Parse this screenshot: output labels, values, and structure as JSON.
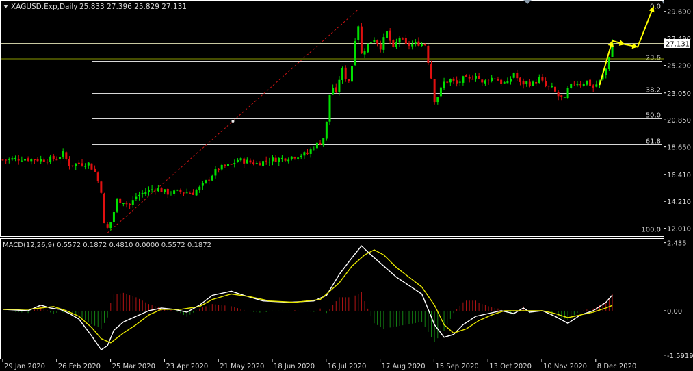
{
  "header": {
    "symbol": "XAGUSD.Exp,Daily",
    "ohlc": "25.833 27.396 25.829 27.131"
  },
  "colors": {
    "background": "#000000",
    "grid": "#ffffff",
    "bull": "#00e000",
    "bear": "#e01010",
    "fib_line": "#d8d8d8",
    "fib_diag": "#c81414",
    "price_line": "#c8c8a0",
    "arrows": "#ffff00",
    "macd_line": "#ffffff",
    "signal_line": "#e8e800",
    "hist_pos": "#b41414",
    "hist_neg": "#148214",
    "text": "#d8d8d8"
  },
  "icons": [
    "dropdown-triangle-icon",
    "scroll-marker-icon",
    "shift-marker-icon"
  ],
  "price_scale": {
    "ticks": [
      "29.690",
      "27.490",
      "25.290",
      "23.050",
      "20.850",
      "18.650",
      "16.410",
      "14.210",
      "12.010"
    ],
    "current_price": "27.131"
  },
  "fibonacci": {
    "levels": [
      {
        "label": "0.0",
        "price": 29.86
      },
      {
        "label": "23.6",
        "price": 25.65
      },
      {
        "label": "38.2",
        "price": 23.05
      },
      {
        "label": "50.0",
        "price": 20.95
      },
      {
        "label": "61.8",
        "price": 18.85
      },
      {
        "label": "100.0",
        "price": 11.64
      }
    ]
  },
  "x_axis": {
    "labels": [
      "29 Jan 2020",
      "26 Feb 2020",
      "25 Mar 2020",
      "23 Apr 2020",
      "21 May 2020",
      "18 Jun 2020",
      "16 Jul 2020",
      "17 Aug 2020",
      "15 Sep 2020",
      "13 Oct 2020",
      "10 Nov 2020",
      "8 Dec 2020"
    ]
  },
  "macd": {
    "label": "MACD(12,26,9) 0.5572 0.1872 0.4810 0.0000 0.5572 0.1872",
    "ticks": [
      "2.435",
      "0.00",
      "-1.5919"
    ]
  },
  "chart_data": {
    "type": "candlestick",
    "title": "XAGUSD.Exp,Daily",
    "ylim": [
      11.6,
      30.4
    ],
    "x_labels": [
      "29 Jan 2020",
      "26 Feb 2020",
      "25 Mar 2020",
      "23 Apr 2020",
      "21 May 2020",
      "18 Jun 2020",
      "16 Jul 2020",
      "17 Aug 2020",
      "15 Sep 2020",
      "13 Oct 2020",
      "10 Nov 2020",
      "8 Dec 2020"
    ],
    "close_path": [
      [
        0,
        17.6
      ],
      [
        6,
        17.7
      ],
      [
        12,
        17.6
      ],
      [
        17,
        17.7
      ],
      [
        19,
        18.1
      ],
      [
        21,
        17.2
      ],
      [
        24,
        17.3
      ],
      [
        27,
        17.3
      ],
      [
        29,
        16.6
      ],
      [
        31,
        15.1
      ],
      [
        32,
        12.3
      ],
      [
        33,
        12.0
      ],
      [
        34,
        12.5
      ],
      [
        36,
        14.3
      ],
      [
        38,
        14.2
      ],
      [
        40,
        13.9
      ],
      [
        42,
        14.6
      ],
      [
        45,
        15.0
      ],
      [
        48,
        15.3
      ],
      [
        52,
        14.9
      ],
      [
        56,
        15.0
      ],
      [
        60,
        14.9
      ],
      [
        62,
        15.3
      ],
      [
        64,
        15.8
      ],
      [
        66,
        16.4
      ],
      [
        68,
        16.9
      ],
      [
        72,
        17.2
      ],
      [
        74,
        17.6
      ],
      [
        76,
        17.5
      ],
      [
        80,
        17.3
      ],
      [
        84,
        17.6
      ],
      [
        88,
        17.7
      ],
      [
        92,
        17.9
      ],
      [
        96,
        18.1
      ],
      [
        98,
        18.7
      ],
      [
        100,
        19.0
      ],
      [
        101,
        19.4
      ],
      [
        102,
        20.6
      ],
      [
        103,
        22.9
      ],
      [
        104,
        23.5
      ],
      [
        105,
        22.9
      ],
      [
        106,
        24.2
      ],
      [
        107,
        24.9
      ],
      [
        108,
        24.3
      ],
      [
        109,
        24.1
      ],
      [
        110,
        25.3
      ],
      [
        111,
        27.5
      ],
      [
        112,
        28.6
      ],
      [
        113,
        26.2
      ],
      [
        115,
        27.0
      ],
      [
        117,
        27.5
      ],
      [
        119,
        26.8
      ],
      [
        121,
        28.0
      ],
      [
        123,
        26.6
      ],
      [
        125,
        27.6
      ],
      [
        127,
        26.9
      ],
      [
        129,
        27.0
      ],
      [
        131,
        27.1
      ],
      [
        133,
        27.0
      ],
      [
        135,
        24.3
      ],
      [
        136,
        22.5
      ],
      [
        137,
        22.8
      ],
      [
        139,
        23.9
      ],
      [
        141,
        24.1
      ],
      [
        143,
        23.8
      ],
      [
        145,
        24.2
      ],
      [
        147,
        24.1
      ],
      [
        149,
        24.6
      ],
      [
        151,
        23.8
      ],
      [
        153,
        24.2
      ],
      [
        155,
        24.3
      ],
      [
        157,
        23.9
      ],
      [
        159,
        23.8
      ],
      [
        161,
        24.7
      ],
      [
        163,
        23.8
      ],
      [
        165,
        23.9
      ],
      [
        167,
        23.8
      ],
      [
        169,
        24.2
      ],
      [
        171,
        23.6
      ],
      [
        173,
        23.4
      ],
      [
        175,
        22.8
      ],
      [
        177,
        22.5
      ],
      [
        178,
        23.3
      ],
      [
        180,
        23.9
      ],
      [
        182,
        23.8
      ],
      [
        184,
        24.0
      ],
      [
        186,
        23.5
      ],
      [
        188,
        24.0
      ],
      [
        190,
        25.0
      ],
      [
        192,
        27.1
      ]
    ],
    "projection_arrows": [
      [
        [
          188,
          23.7
        ],
        [
          192,
          27.3
        ]
      ],
      [
        [
          192,
          27.3
        ],
        [
          196,
          27.0
        ]
      ],
      [
        [
          196,
          27.0
        ],
        [
          200,
          26.8
        ]
      ],
      [
        [
          200,
          26.8
        ],
        [
          205,
          30.1
        ]
      ]
    ],
    "macd_ylim": [
      -1.62,
      2.5
    ],
    "macd_path": [
      [
        0,
        0.05
      ],
      [
        8,
        0.0
      ],
      [
        12,
        0.2
      ],
      [
        15,
        0.1
      ],
      [
        18,
        0.05
      ],
      [
        21,
        -0.1
      ],
      [
        24,
        -0.3
      ],
      [
        28,
        -0.9
      ],
      [
        31,
        -1.4
      ],
      [
        33,
        -1.25
      ],
      [
        35,
        -0.7
      ],
      [
        38,
        -0.4
      ],
      [
        42,
        -0.2
      ],
      [
        46,
        -0.0
      ],
      [
        50,
        0.1
      ],
      [
        54,
        0.05
      ],
      [
        58,
        -0.05
      ],
      [
        62,
        0.2
      ],
      [
        66,
        0.55
      ],
      [
        72,
        0.7
      ],
      [
        76,
        0.55
      ],
      [
        82,
        0.35
      ],
      [
        90,
        0.3
      ],
      [
        98,
        0.35
      ],
      [
        102,
        0.55
      ],
      [
        106,
        1.3
      ],
      [
        110,
        1.9
      ],
      [
        113,
        2.32
      ],
      [
        116,
        2.0
      ],
      [
        120,
        1.6
      ],
      [
        124,
        1.2
      ],
      [
        128,
        0.9
      ],
      [
        132,
        0.6
      ],
      [
        136,
        -0.5
      ],
      [
        139,
        -0.95
      ],
      [
        142,
        -0.85
      ],
      [
        145,
        -0.5
      ],
      [
        149,
        -0.2
      ],
      [
        153,
        -0.1
      ],
      [
        157,
        0.0
      ],
      [
        161,
        -0.1
      ],
      [
        164,
        0.1
      ],
      [
        166,
        -0.05
      ],
      [
        170,
        0.0
      ],
      [
        174,
        -0.2
      ],
      [
        178,
        -0.45
      ],
      [
        182,
        -0.15
      ],
      [
        186,
        0.0
      ],
      [
        190,
        0.3
      ],
      [
        192,
        0.56
      ]
    ],
    "signal_path": [
      [
        0,
        0.05
      ],
      [
        8,
        0.05
      ],
      [
        12,
        0.1
      ],
      [
        16,
        0.15
      ],
      [
        20,
        0.0
      ],
      [
        24,
        -0.2
      ],
      [
        28,
        -0.6
      ],
      [
        31,
        -1.0
      ],
      [
        34,
        -1.15
      ],
      [
        38,
        -0.8
      ],
      [
        42,
        -0.5
      ],
      [
        46,
        -0.15
      ],
      [
        50,
        0.05
      ],
      [
        56,
        0.05
      ],
      [
        62,
        0.15
      ],
      [
        66,
        0.4
      ],
      [
        72,
        0.6
      ],
      [
        78,
        0.5
      ],
      [
        84,
        0.35
      ],
      [
        92,
        0.3
      ],
      [
        100,
        0.4
      ],
      [
        106,
        1.0
      ],
      [
        110,
        1.6
      ],
      [
        114,
        2.0
      ],
      [
        117,
        2.18
      ],
      [
        120,
        2.0
      ],
      [
        124,
        1.55
      ],
      [
        128,
        1.2
      ],
      [
        132,
        0.85
      ],
      [
        136,
        0.2
      ],
      [
        139,
        -0.5
      ],
      [
        142,
        -0.8
      ],
      [
        146,
        -0.65
      ],
      [
        150,
        -0.35
      ],
      [
        154,
        -0.15
      ],
      [
        158,
        0.0
      ],
      [
        162,
        0.0
      ],
      [
        166,
        0.0
      ],
      [
        170,
        0.0
      ],
      [
        174,
        -0.1
      ],
      [
        178,
        -0.25
      ],
      [
        182,
        -0.15
      ],
      [
        186,
        -0.05
      ],
      [
        190,
        0.1
      ],
      [
        192,
        0.19
      ]
    ]
  }
}
